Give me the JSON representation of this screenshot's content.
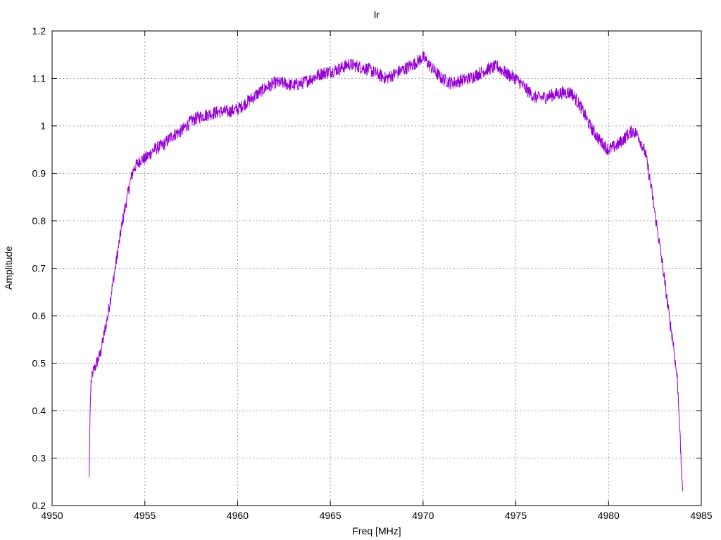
{
  "chart_data": {
    "type": "line",
    "title": "lr",
    "xlabel": "Freq [MHz]",
    "ylabel": "Amplitude",
    "xlim": [
      4950,
      4985
    ],
    "ylim": [
      0.2,
      1.2
    ],
    "xticks": [
      4950,
      4955,
      4960,
      4965,
      4970,
      4975,
      4980,
      4985
    ],
    "yticks": [
      0.2,
      0.3,
      0.4,
      0.5,
      0.6,
      0.7,
      0.8,
      0.9,
      1,
      1.1,
      1.2
    ],
    "x_tick_labels": [
      "4950",
      "4955",
      "4960",
      "4965",
      "4970",
      "4975",
      "4980",
      "4985"
    ],
    "y_tick_labels": [
      "0.2",
      "0.3",
      "0.4",
      "0.5",
      "0.6",
      "0.7",
      "0.8",
      "0.9",
      "1",
      "1.1",
      "1.2"
    ],
    "grid": true,
    "legend": "none",
    "series": [
      {
        "color": "#9400d3",
        "x": [
          4952.0,
          4952.05,
          4952.1,
          4952.2,
          4952.4,
          4952.6,
          4952.8,
          4953.0,
          4953.2,
          4953.4,
          4953.6,
          4953.8,
          4954.0,
          4954.2,
          4954.4,
          4954.6,
          4954.8,
          4955.0,
          4955.5,
          4956.0,
          4956.5,
          4957.0,
          4957.5,
          4958.0,
          4958.5,
          4959.0,
          4959.5,
          4960.0,
          4960.5,
          4961.0,
          4961.5,
          4962.0,
          4962.5,
          4963.0,
          4963.5,
          4964.0,
          4964.5,
          4965.0,
          4965.5,
          4966.0,
          4966.5,
          4967.0,
          4967.5,
          4968.0,
          4968.5,
          4969.0,
          4969.5,
          4970.0,
          4970.5,
          4971.0,
          4971.5,
          4972.0,
          4972.5,
          4973.0,
          4973.5,
          4974.0,
          4974.5,
          4975.0,
          4975.5,
          4976.0,
          4976.5,
          4977.0,
          4977.5,
          4978.0,
          4978.5,
          4979.0,
          4979.5,
          4980.0,
          4980.5,
          4981.0,
          4981.3,
          4981.6,
          4982.0,
          4982.3,
          4982.6,
          4982.9,
          4983.1,
          4983.3,
          4983.5,
          4983.6,
          4983.7,
          4983.8,
          4983.9,
          4984.0
        ],
        "y": [
          0.26,
          0.4,
          0.46,
          0.48,
          0.5,
          0.52,
          0.56,
          0.6,
          0.65,
          0.7,
          0.75,
          0.8,
          0.84,
          0.88,
          0.91,
          0.92,
          0.93,
          0.93,
          0.95,
          0.96,
          0.98,
          0.99,
          1.01,
          1.02,
          1.025,
          1.03,
          1.03,
          1.035,
          1.05,
          1.065,
          1.08,
          1.09,
          1.09,
          1.085,
          1.09,
          1.1,
          1.11,
          1.115,
          1.12,
          1.13,
          1.125,
          1.12,
          1.11,
          1.1,
          1.11,
          1.12,
          1.13,
          1.145,
          1.12,
          1.1,
          1.09,
          1.095,
          1.1,
          1.11,
          1.12,
          1.125,
          1.11,
          1.1,
          1.08,
          1.06,
          1.06,
          1.065,
          1.07,
          1.07,
          1.04,
          1.0,
          0.97,
          0.95,
          0.96,
          0.98,
          0.99,
          0.98,
          0.94,
          0.87,
          0.79,
          0.71,
          0.65,
          0.59,
          0.54,
          0.5,
          0.47,
          0.4,
          0.3,
          0.23
        ]
      }
    ]
  }
}
